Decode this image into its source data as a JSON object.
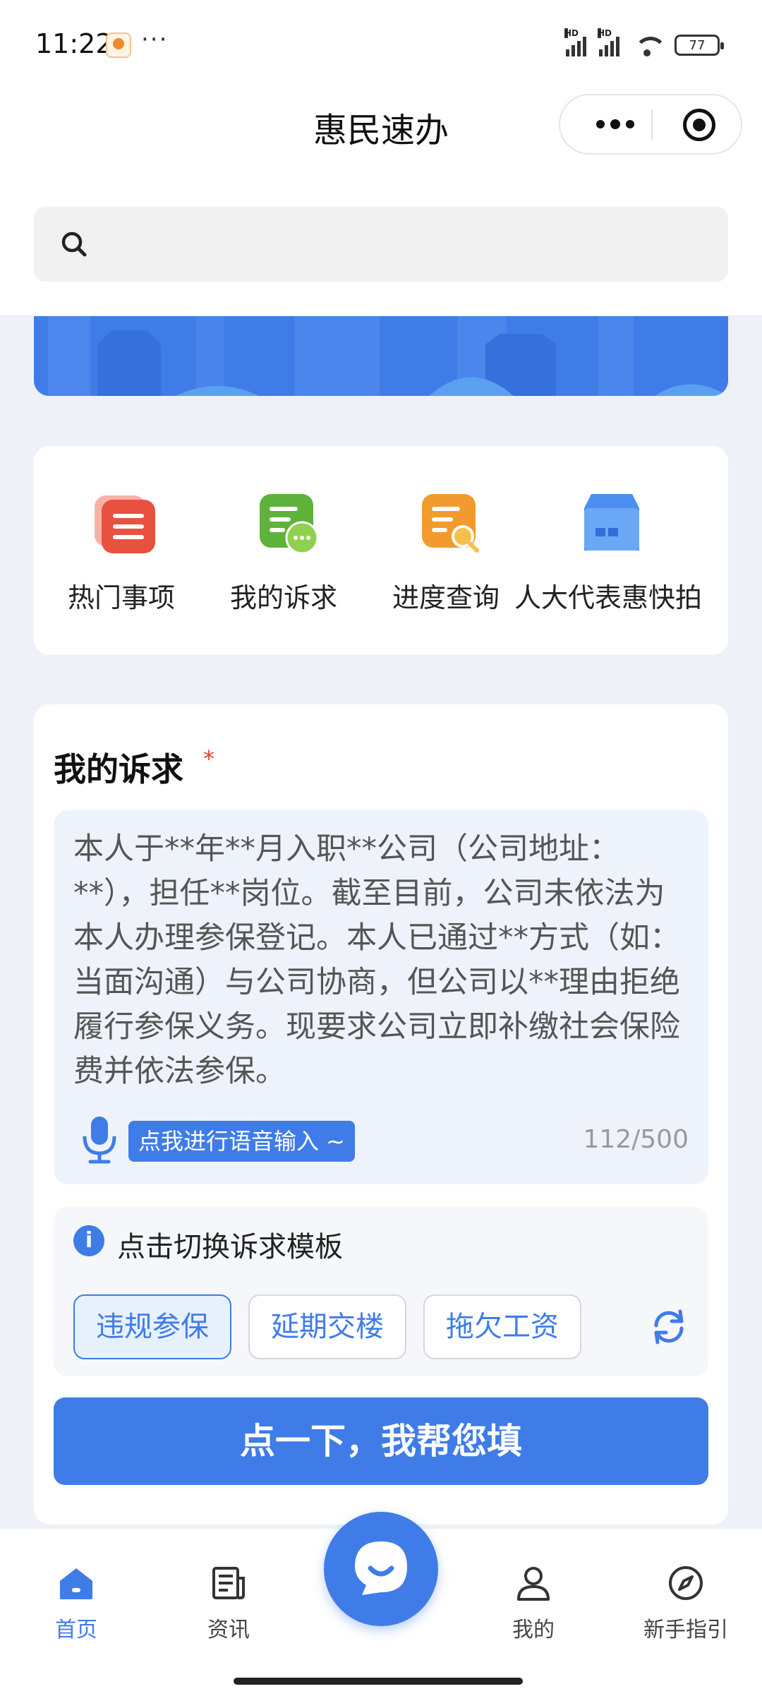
{
  "status_bar": {
    "time": "11:22",
    "more": "···",
    "battery": "77"
  },
  "header": {
    "title": "惠民速办"
  },
  "search": {
    "placeholder": ""
  },
  "quick_menu": [
    {
      "label": "热门事项",
      "icon": "hot-items-icon",
      "color": "#e8503f"
    },
    {
      "label": "我的诉求",
      "icon": "my-requests-icon",
      "color": "#5fb23a"
    },
    {
      "label": "进度查询",
      "icon": "progress-query-icon",
      "color": "#f29a2e"
    },
    {
      "label": "人大代表惠快拍",
      "icon": "deputy-snapshot-icon",
      "color": "#4a8ff0"
    }
  ],
  "request_form": {
    "title": "我的诉求",
    "required_mark": "*",
    "content": "本人于**年**月入职**公司（公司地址：**），担任**岗位。截至目前，公司未依法为本人办理参保登记。本人已通过**方式（如：当面沟通）与公司协商，但公司以**理由拒绝履行参保义务。现要求公司立即补缴社会保险费并依法参保。",
    "voice_button": "点我进行语音输入 ~",
    "char_count": "112/500",
    "template_hint": "点击切换诉求模板",
    "templates": [
      {
        "label": "违规参保",
        "selected": true
      },
      {
        "label": "延期交楼",
        "selected": false
      },
      {
        "label": "拖欠工资",
        "selected": false
      }
    ],
    "submit_label": "点一下，我帮您填"
  },
  "bottom_nav": [
    {
      "label": "首页",
      "icon": "home-icon",
      "active": true
    },
    {
      "label": "资讯",
      "icon": "news-icon",
      "active": false
    },
    {
      "label": "我的",
      "icon": "profile-icon",
      "active": false
    },
    {
      "label": "新手指引",
      "icon": "compass-icon",
      "active": false
    }
  ],
  "colors": {
    "primary": "#3f7ce8",
    "background": "#eef2f8",
    "required": "#e0413a"
  }
}
